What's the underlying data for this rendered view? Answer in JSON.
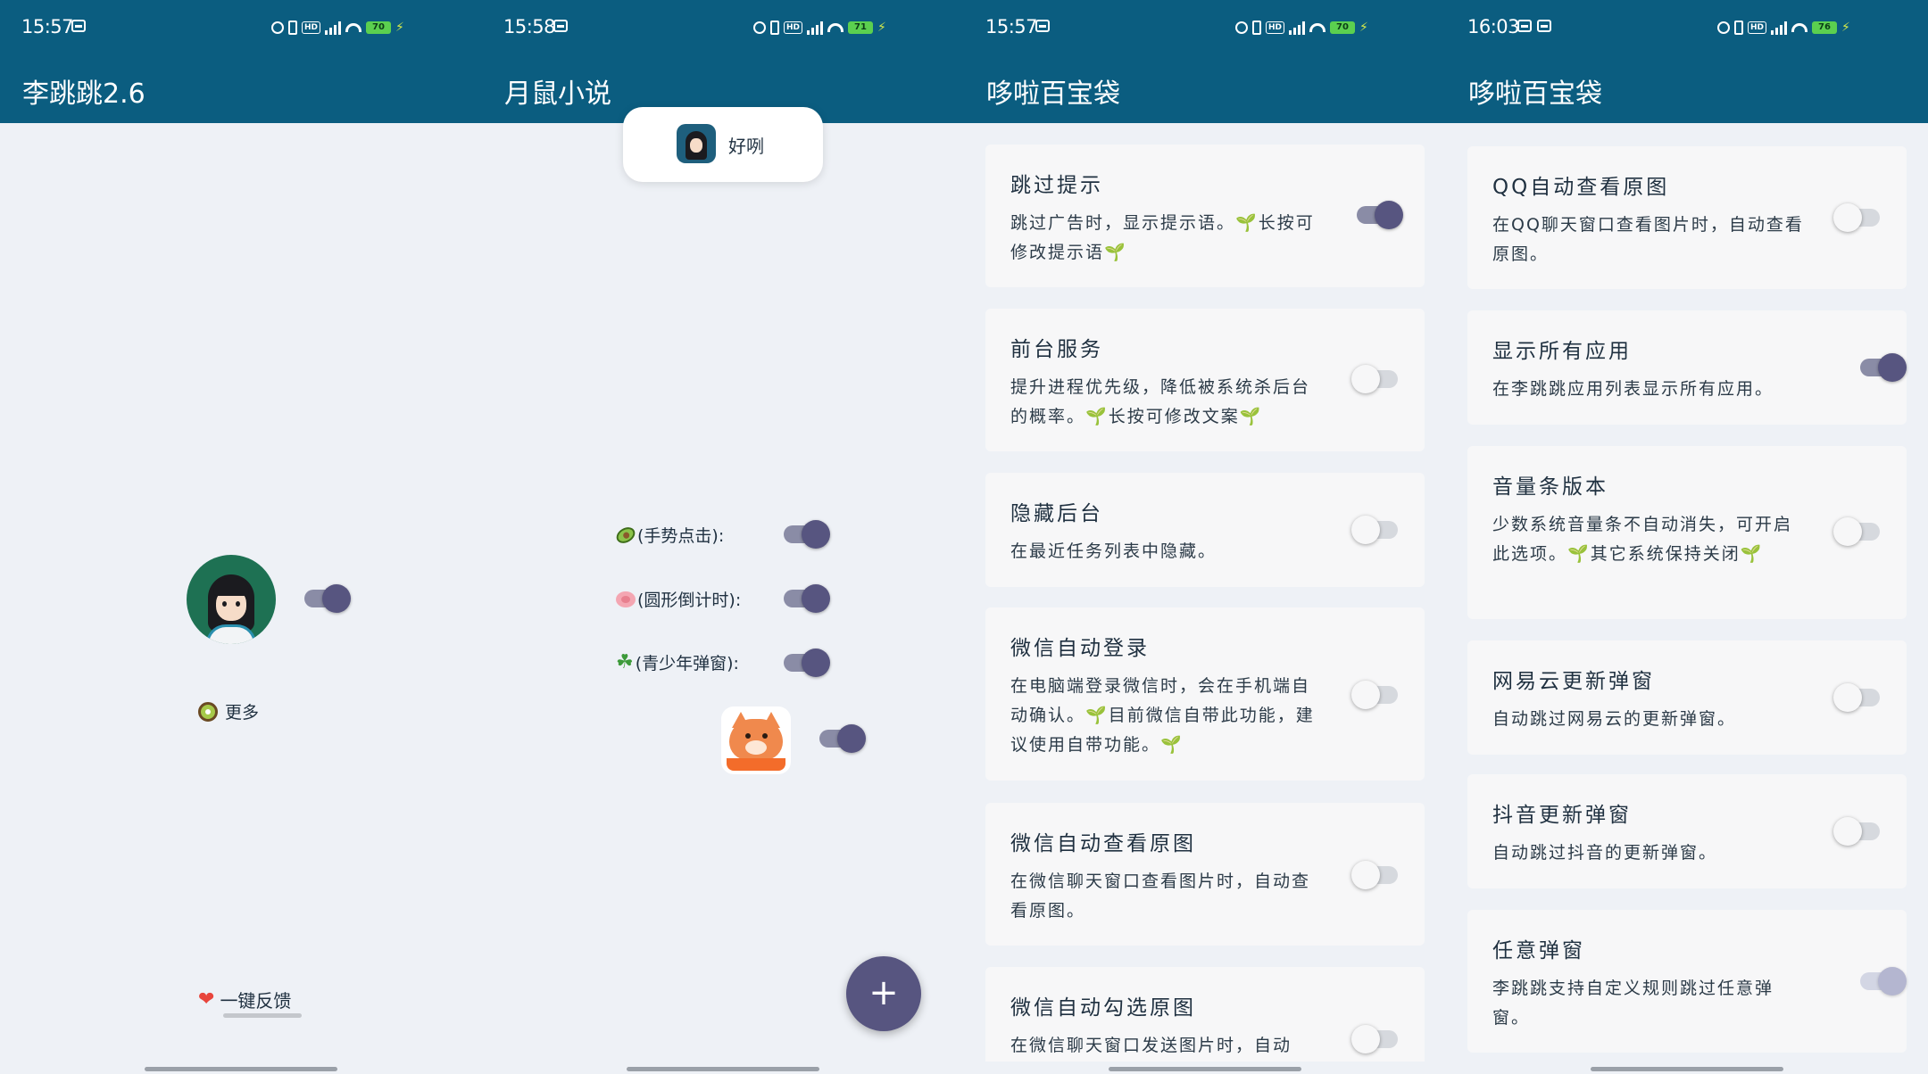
{
  "screens": [
    {
      "status": {
        "time": "15:57",
        "battery": "70"
      },
      "title": "李跳跳2.6",
      "more_label": "更多",
      "feedback_label": "一键反馈"
    },
    {
      "status": {
        "time": "15:58",
        "battery": "71"
      },
      "title": "月鼠小说",
      "toast_text": "好咧",
      "options": [
        "(手势点击):",
        "(圆形倒计时):",
        "(青少年弹窗):"
      ],
      "fab_label": "+"
    },
    {
      "status": {
        "time": "15:57",
        "battery": "70"
      },
      "title": "哆啦百宝袋",
      "cards": [
        {
          "title": "跳过提示",
          "desc": "跳过广告时，显示提示语。",
          "desc_extra": "长按可修改提示语",
          "switch": "on"
        },
        {
          "title": "前台服务",
          "desc": "提升进程优先级，降低被系统杀后台的概率。",
          "desc_extra": "长按可修改文案",
          "switch": "off"
        },
        {
          "title": "隐藏后台",
          "desc": "在最近任务列表中隐藏。",
          "switch": "off"
        },
        {
          "title": "微信自动登录",
          "desc": "在电脑端登录微信时，会在手机端自动确认。",
          "desc_extra": "目前微信自带此功能，建议使用自带功能。",
          "switch": "off"
        },
        {
          "title": "微信自动查看原图",
          "desc": "在微信聊天窗口查看图片时，自动查看原图。",
          "switch": "off"
        },
        {
          "title": "微信自动勾选原图",
          "desc": "在微信聊天窗口发送图片时，自动",
          "switch": "off"
        }
      ]
    },
    {
      "status": {
        "time": "16:03",
        "battery": "76"
      },
      "title": "哆啦百宝袋",
      "cards": [
        {
          "title": "QQ自动查看原图",
          "desc": "在QQ聊天窗口查看图片时，自动查看原图。",
          "switch": "off"
        },
        {
          "title": "显示所有应用",
          "desc": "在李跳跳应用列表显示所有应用。",
          "switch": "on"
        },
        {
          "title": "音量条版本",
          "desc": "少数系统音量条不自动消失，可开启此选项。",
          "desc_extra": "其它系统保持关闭",
          "switch": "off"
        },
        {
          "title": "网易云更新弹窗",
          "desc": "自动跳过网易云的更新弹窗。",
          "switch": "off"
        },
        {
          "title": "抖音更新弹窗",
          "desc": "自动跳过抖音的更新弹窗。",
          "switch": "off"
        },
        {
          "title": "任意弹窗",
          "desc": "李跳跳支持自定义规则跳过任意弹窗。",
          "switch": "disabled"
        }
      ]
    }
  ],
  "colors": {
    "appbar": "#0b5d80",
    "background": "#eef1f6",
    "card": "#f7f7f8",
    "switch_on": "#575580",
    "battery": "#5bd04f"
  },
  "icons": {
    "alarm": "alarm-icon",
    "vibrate": "vibrate-icon",
    "signal": "signal-icon",
    "wifi": "wifi-icon",
    "battery": "battery-icon",
    "sprout": "sprout-icon",
    "heart": "heart-icon",
    "kiwi": "kiwi-icon"
  }
}
